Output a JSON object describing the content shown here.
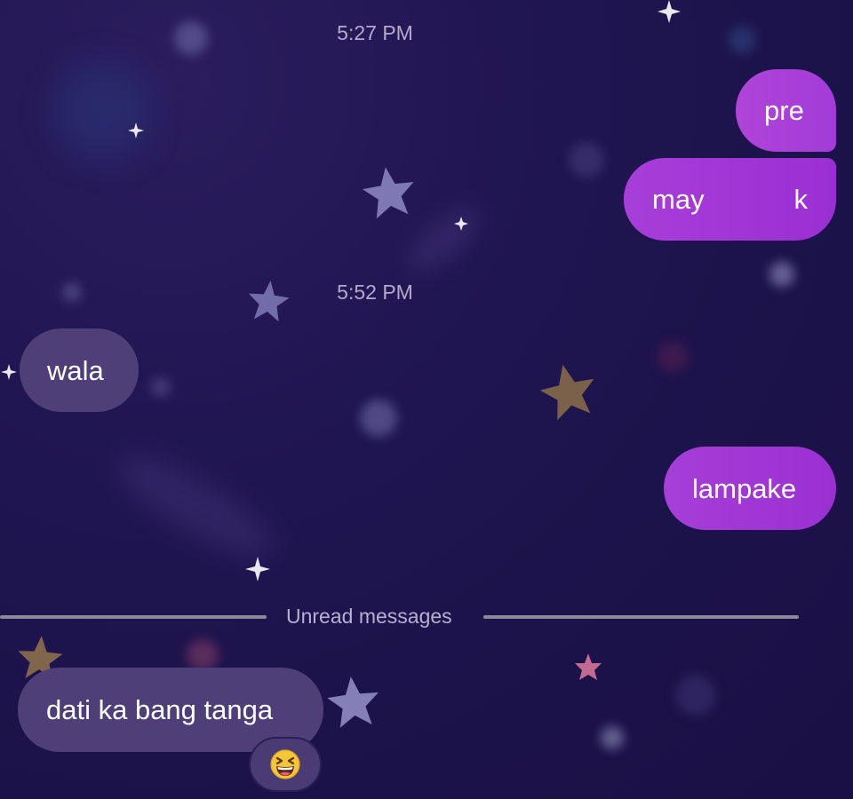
{
  "chat": {
    "timestamps": [
      "5:27 PM",
      "5:52 PM"
    ],
    "messages": [
      {
        "direction": "outgoing",
        "text": "pre"
      },
      {
        "direction": "outgoing",
        "text_parts": [
          "may",
          "k"
        ]
      },
      {
        "direction": "incoming",
        "text": "wala"
      },
      {
        "direction": "outgoing",
        "text": "lampake"
      },
      {
        "direction": "incoming",
        "text": "dati ka bang tanga",
        "reaction": "laughing-face-emoji"
      }
    ],
    "unread_divider": "Unread messages"
  },
  "colors": {
    "background": "#1f1550",
    "outgoing_bubble": "#a338d6",
    "incoming_bubble": "#4f3f78",
    "timestamp_text": "#b3aacd"
  },
  "background_decorations": [
    "star-icon",
    "sparkle-icon",
    "bokeh-dot"
  ]
}
